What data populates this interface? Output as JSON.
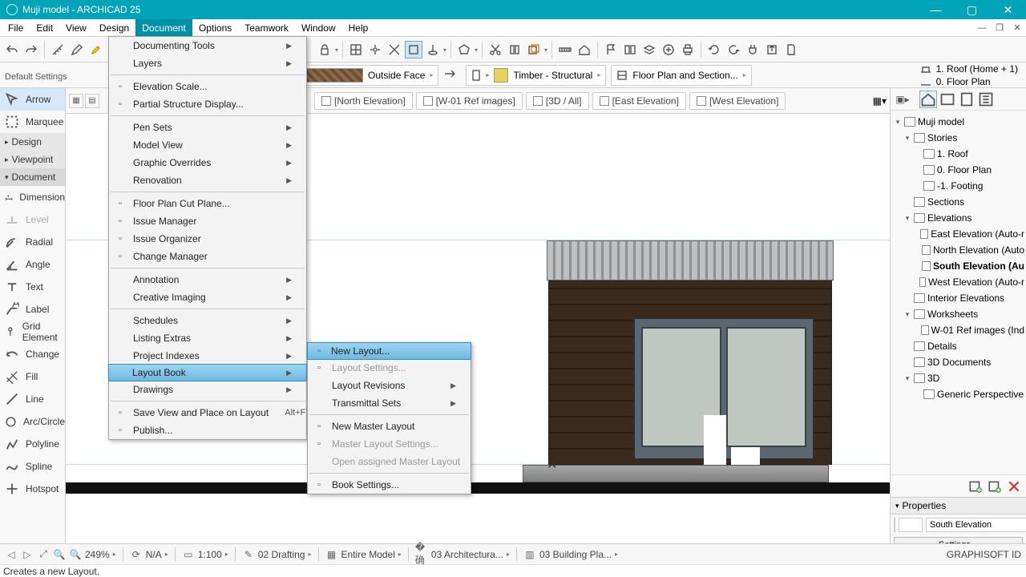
{
  "window": {
    "title": "Muji model - ARCHICAD 25"
  },
  "menubar": [
    "File",
    "Edit",
    "View",
    "Design",
    "Document",
    "Options",
    "Teamwork",
    "Window",
    "Help"
  ],
  "menubar_open_index": 4,
  "doc_menu": [
    {
      "label": "Documenting Tools",
      "sub": true
    },
    {
      "label": "Layers",
      "sub": true
    },
    {
      "div": true
    },
    {
      "label": "Elevation Scale...",
      "icon": "scale"
    },
    {
      "label": "Partial Structure Display...",
      "icon": "psd"
    },
    {
      "div": true
    },
    {
      "label": "Pen Sets",
      "sub": true
    },
    {
      "label": "Model View",
      "sub": true
    },
    {
      "label": "Graphic Overrides",
      "sub": true
    },
    {
      "label": "Renovation",
      "sub": true
    },
    {
      "div": true
    },
    {
      "label": "Floor Plan Cut Plane...",
      "icon": "fp"
    },
    {
      "label": "Issue Manager",
      "icon": "im"
    },
    {
      "label": "Issue Organizer",
      "icon": "io"
    },
    {
      "label": "Change Manager",
      "icon": "cm"
    },
    {
      "div": true
    },
    {
      "label": "Annotation",
      "sub": true
    },
    {
      "label": "Creative Imaging",
      "sub": true
    },
    {
      "div": true
    },
    {
      "label": "Schedules",
      "sub": true
    },
    {
      "label": "Listing Extras",
      "sub": true
    },
    {
      "label": "Project Indexes",
      "sub": true
    },
    {
      "label": "Layout Book",
      "sub": true,
      "hl": true
    },
    {
      "label": "Drawings",
      "sub": true
    },
    {
      "div": true
    },
    {
      "label": "Save View and Place on Layout",
      "kb": "Alt+F7",
      "icon": "sv"
    },
    {
      "label": "Publish...",
      "icon": "pub"
    }
  ],
  "layout_submenu": [
    {
      "label": "New Layout...",
      "icon": "nl",
      "hl": true
    },
    {
      "label": "Layout Settings...",
      "dis": true,
      "icon": "ls"
    },
    {
      "label": "Layout Revisions",
      "sub": true
    },
    {
      "label": "Transmittal Sets",
      "sub": true
    },
    {
      "div": true
    },
    {
      "label": "New Master Layout",
      "icon": "nm"
    },
    {
      "label": "Master Layout Settings...",
      "dis": true,
      "icon": "ms"
    },
    {
      "label": "Open assigned Master Layout",
      "dis": true
    },
    {
      "div": true
    },
    {
      "label": "Book Settings...",
      "icon": "bs"
    }
  ],
  "default_settings": "Default Settings",
  "toolbar_info": {
    "face": "Outside Face",
    "material": "Timber - Structural",
    "view": "Floor Plan and Section..."
  },
  "floors": {
    "upper": "1. Roof (Home + 1)",
    "current": "0. Floor Plan"
  },
  "view_tabs": [
    "[North Elevation]",
    "[W-01 Ref images]",
    "[3D / All]",
    "[East Elevation]",
    "[West Elevation]"
  ],
  "tool_sections": {
    "design": "Design",
    "viewpoint": "Viewpoint",
    "document": "Document"
  },
  "tools": [
    "Arrow",
    "Marquee"
  ],
  "doc_tools": [
    "Dimension",
    "Level",
    "Radial",
    "Angle",
    "Text",
    "Label",
    "Grid Element",
    "Change",
    "Fill",
    "Line",
    "Arc/Circle",
    "Polyline",
    "Spline",
    "Hotspot"
  ],
  "navigator": {
    "root": "Muji model",
    "stories": [
      "1. Roof",
      "0. Floor Plan",
      "-1. Footing"
    ],
    "sections": "Sections",
    "elevations_label": "Elevations",
    "elevations": [
      "East Elevation (Auto-r",
      "North Elevation (Auto",
      "South Elevation (Au",
      "West Elevation (Auto-r"
    ],
    "interior": "Interior Elevations",
    "worksheets_label": "Worksheets",
    "worksheets": [
      "W-01 Ref images (Ind"
    ],
    "details": "Details",
    "docs3d": "3D Documents",
    "three_d_label": "3D",
    "three_d": [
      "Generic Perspective"
    ]
  },
  "selected_elev_index": 2,
  "properties": {
    "title": "Properties",
    "value": "South Elevation",
    "settings": "Settings..."
  },
  "bottom": {
    "zoom": "249%",
    "na": "N/A",
    "scale": "1:100",
    "opt": "02 Drafting",
    "model": "Entire Model",
    "arch": "03 Architectura...",
    "plan": "03 Building Pla..."
  },
  "brand": "GRAPHISOFT ID",
  "hint": "Creates a new Layout."
}
